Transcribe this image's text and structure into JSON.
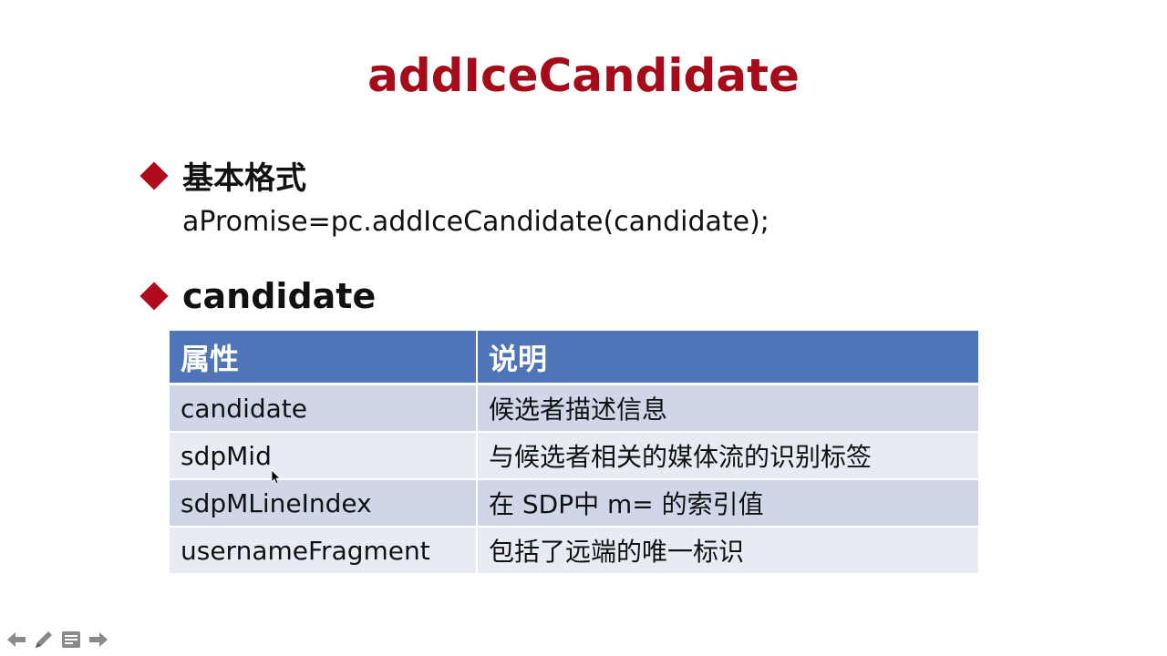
{
  "slide": {
    "title": "addIceCandidate",
    "section1": {
      "heading": "基本格式",
      "code": "aPromise=pc.addIceCandidate(candidate);"
    },
    "section2": {
      "heading": "candidate"
    },
    "table": {
      "headers": [
        "属性",
        "说明"
      ],
      "rows": [
        [
          "candidate",
          "候选者描述信息"
        ],
        [
          "sdpMid",
          "与候选者相关的媒体流的识别标签"
        ],
        [
          "sdpMLineIndex",
          "在 SDP中 m= 的索引值"
        ],
        [
          "usernameFragment",
          "包括了远端的唯一标识"
        ]
      ]
    }
  },
  "colors": {
    "title": "#a50b18",
    "bullet": "#b00a1c",
    "table_header": "#4f74b8",
    "row_dark": "#cfd6e8",
    "row_light": "#e8ebf4"
  },
  "toolbar": {
    "icons": [
      "arrow-left-icon",
      "pen-icon",
      "menu-icon",
      "arrow-right-icon"
    ]
  }
}
